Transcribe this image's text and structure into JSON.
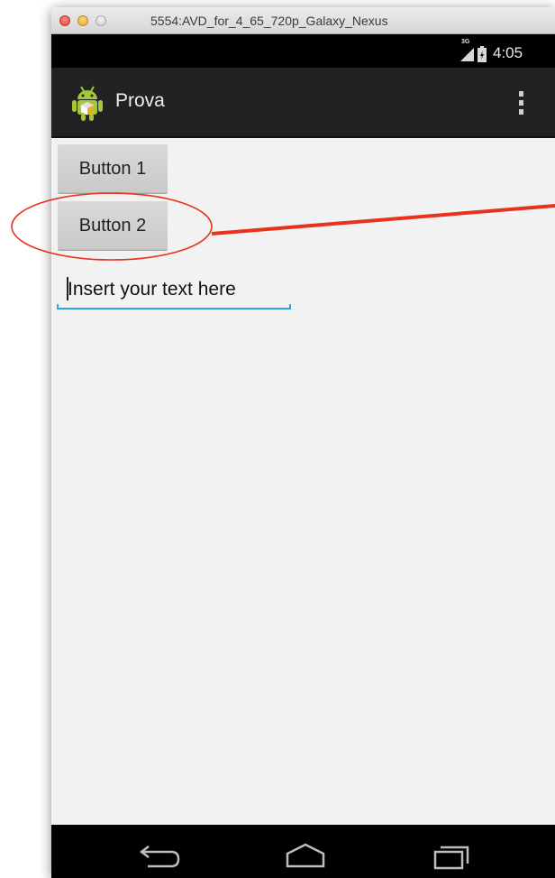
{
  "window": {
    "title": "5554:AVD_for_4_65_720p_Galaxy_Nexus"
  },
  "status_bar": {
    "network": "3G",
    "time": "4:05"
  },
  "action_bar": {
    "app_icon": "android-robot-icon",
    "title": "Prova",
    "overflow_icon": "overflow-menu-icon"
  },
  "content": {
    "button1_label": "Button 1",
    "button2_label": "Button 2",
    "edit_text_value": "Insert your text here"
  },
  "nav_bar": {
    "back_icon": "back-icon",
    "home_icon": "home-icon",
    "recents_icon": "recents-icon"
  },
  "colors": {
    "annotation": "#e8321e",
    "edit_underline": "#33a4d6",
    "action_bar_bg": "#222222",
    "content_bg": "#f2f2f2"
  }
}
